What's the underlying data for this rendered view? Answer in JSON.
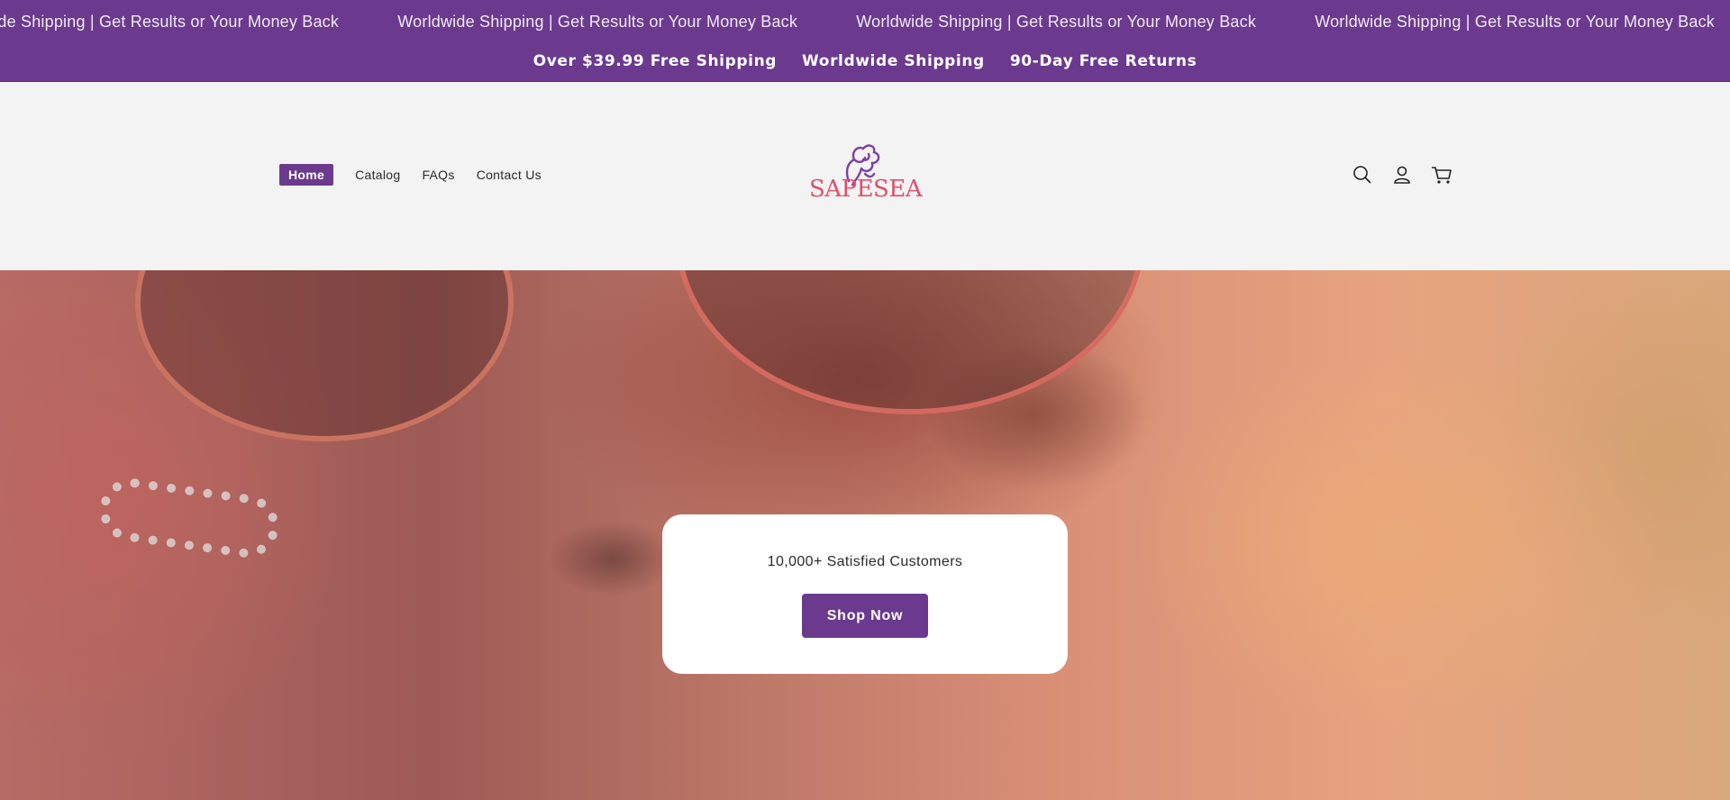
{
  "announcement": {
    "marquee_items": [
      "wide Shipping | Get Results or Your Money Back",
      "Worldwide Shipping | Get Results or Your Money Back",
      "Worldwide Shipping | Get Results or Your Money Back",
      "Worldwide Shipping | Get Results or Your Money Back"
    ],
    "benefits": [
      "Over $39.99 Free Shipping",
      "Worldwide Shipping",
      "90-Day Free Returns"
    ]
  },
  "header": {
    "logo_text": "SAPESEA",
    "nav": [
      {
        "label": "Home",
        "active": true
      },
      {
        "label": "Catalog",
        "active": false
      },
      {
        "label": "FAQs",
        "active": false
      },
      {
        "label": "Contact Us",
        "active": false
      }
    ],
    "icons": [
      "search-icon",
      "account-icon",
      "cart-icon"
    ]
  },
  "hero": {
    "tagline": "10,000+ Satisfied Customers",
    "button_label": "Shop Now"
  },
  "colors": {
    "brand_purple": "#6b3a8f",
    "logo_pink": "#e04f6b",
    "header_bg": "#f3f3f3"
  }
}
